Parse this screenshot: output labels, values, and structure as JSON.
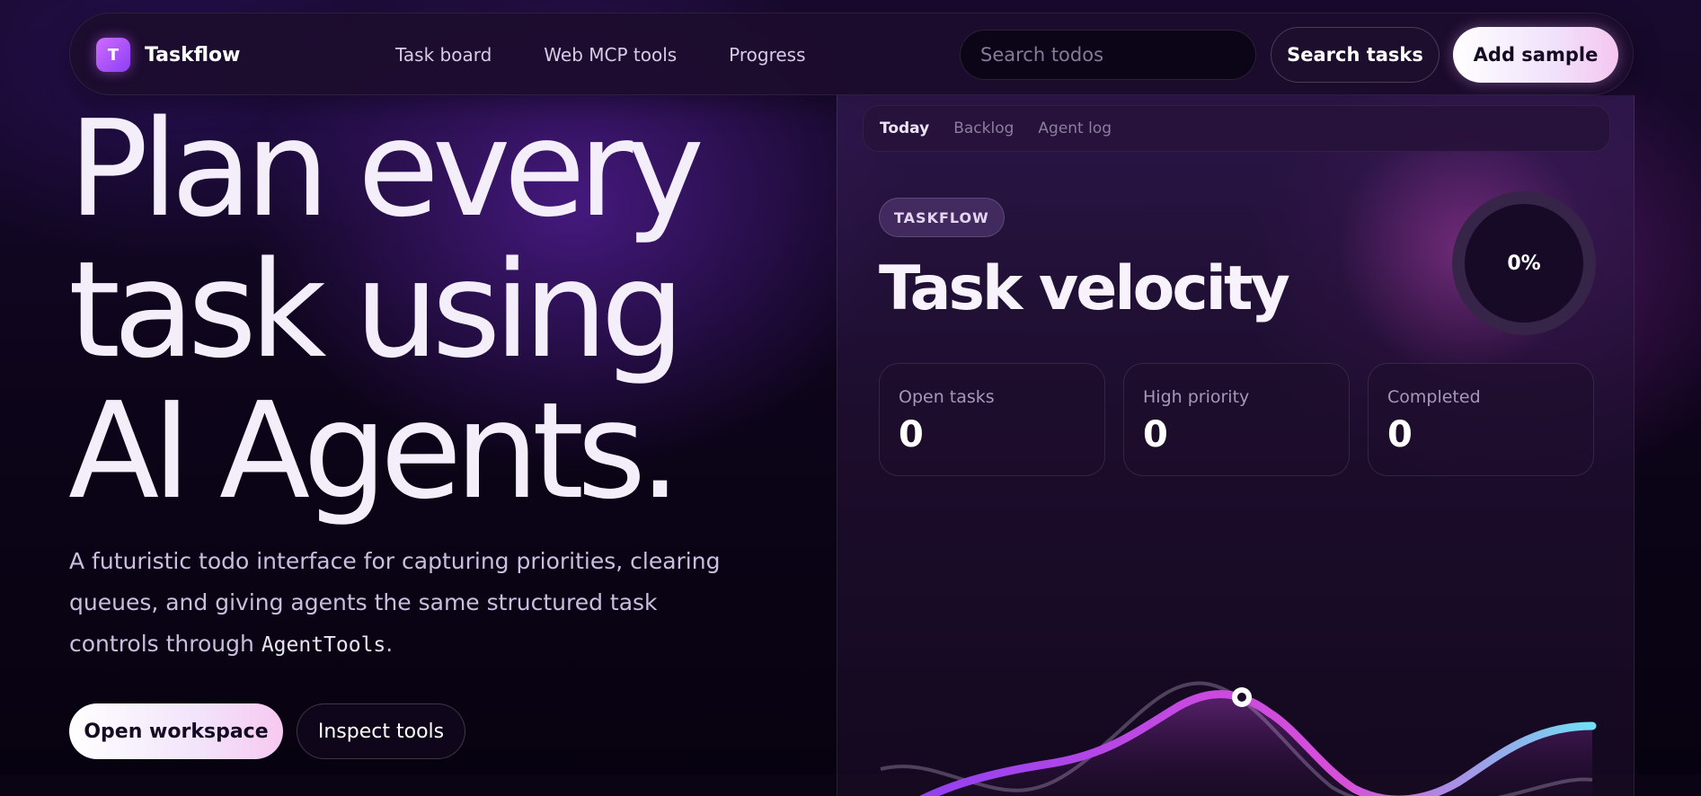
{
  "nav": {
    "brand_initial": "T",
    "brand_name": "Taskflow",
    "links": [
      "Task board",
      "Web MCP tools",
      "Progress"
    ],
    "search_placeholder": "Search todos",
    "search_button": "Search tasks",
    "add_button": "Add sample"
  },
  "hero": {
    "title_lines": [
      "Plan every",
      "task using",
      "AI Agents."
    ],
    "description_before": "A futuristic todo interface for capturing priorities, clearing queues, and giving agents the same structured task controls through ",
    "description_code": "AgentTools",
    "description_after": ".",
    "primary_button": "Open workspace",
    "secondary_button": "Inspect tools"
  },
  "panel": {
    "tabs": [
      "Today",
      "Backlog",
      "Agent log"
    ],
    "active_tab": "Today",
    "chip": "TASKFLOW",
    "title": "Task velocity",
    "completion_percent": "0%",
    "stats": [
      {
        "label": "Open tasks",
        "value": "0"
      },
      {
        "label": "High priority",
        "value": "0"
      },
      {
        "label": "Completed",
        "value": "0"
      }
    ]
  },
  "colors": {
    "accent_purple": "#8a3ff5",
    "accent_pink": "#d64fd8",
    "accent_cyan": "#6fe0f5",
    "background": "#0b0414"
  }
}
